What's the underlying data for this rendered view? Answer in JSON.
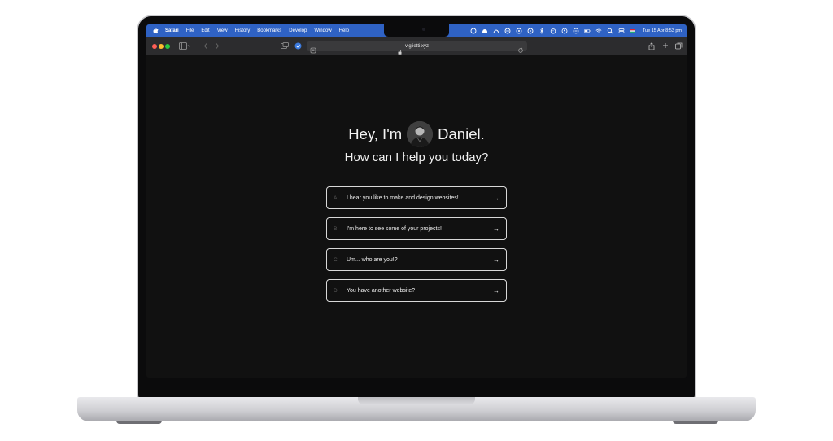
{
  "menubar": {
    "app_name": "Safari",
    "items": [
      "File",
      "Edit",
      "View",
      "History",
      "Bookmarks",
      "Develop",
      "Window",
      "Help"
    ],
    "clock": "Tue 15 Apr  8:53 pm"
  },
  "browser": {
    "url": "viglietti.xyz"
  },
  "hero": {
    "greeting_start": "Hey, I'm",
    "greeting_name": "Daniel.",
    "subtitle": "How can I help you today?"
  },
  "choices": [
    {
      "letter": "A",
      "text": "I hear you like to make and design websites!",
      "arrow": "→"
    },
    {
      "letter": "B",
      "text": "I'm here to see some of your projects!",
      "arrow": "→"
    },
    {
      "letter": "C",
      "text": "Um... who are you!?",
      "arrow": "→"
    },
    {
      "letter": "D",
      "text": "You have another website?",
      "arrow": "→"
    }
  ],
  "colors": {
    "menubar": "#2f62c4",
    "page_bg": "#111111",
    "toolbar": "#2c2c2e"
  }
}
